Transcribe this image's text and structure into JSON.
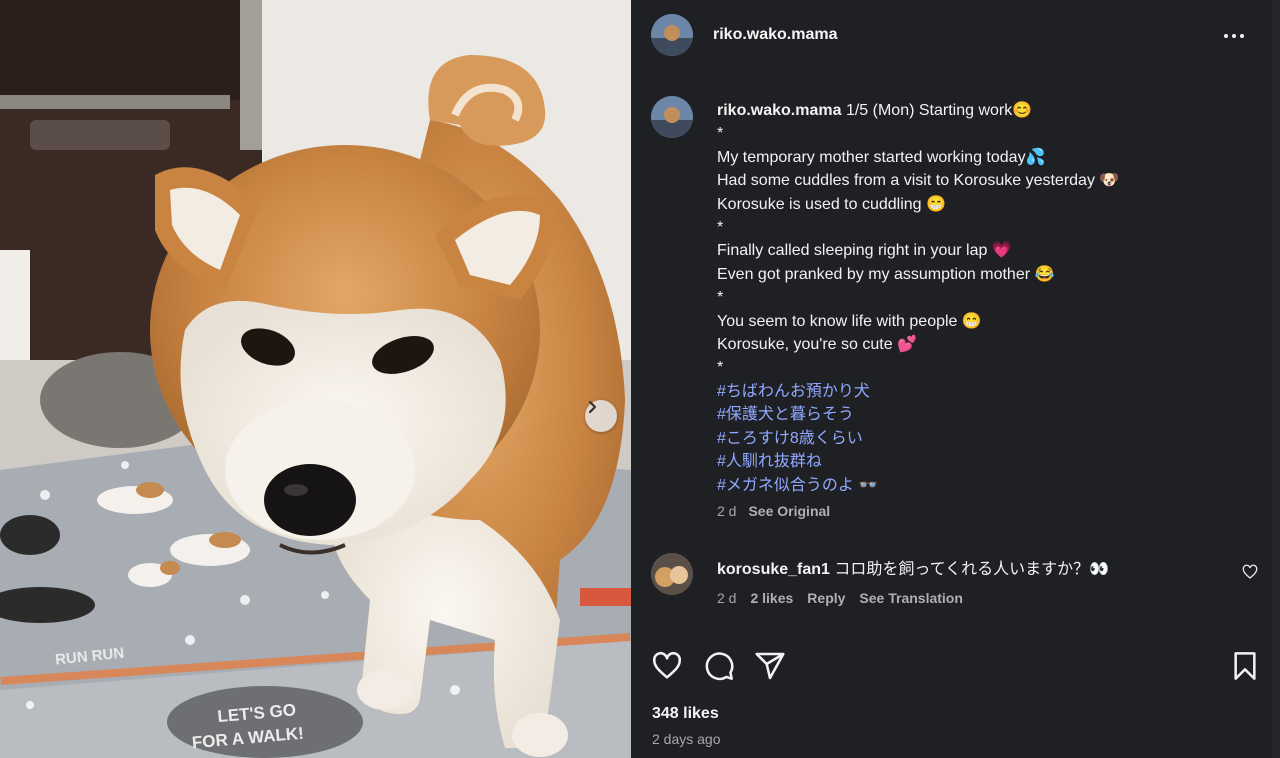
{
  "post": {
    "username": "riko.wako.mama",
    "more_label": "More options",
    "caption": {
      "username": "riko.wako.mama",
      "lines": [
        "1/5 (Mon) Starting work😊",
        " *",
        "My temporary mother started working today💦",
        "Had some cuddles from a visit to Korosuke yesterday 🐶",
        "Korosuke is used to cuddling 😁",
        " *",
        "Finally called sleeping right in your lap 💗",
        "Even got pranked by my assumption mother 😂",
        " *",
        "You seem to know life with people 😁",
        "Korosuke, you're so cute 💕",
        " *"
      ],
      "hashtags": [
        "#ちばわんお預かり犬",
        "#保護犬と暮らそう",
        "#ころすけ8歳くらい",
        "#人馴れ抜群ね",
        "#メガネ似合うのよ 👓"
      ],
      "time": "2 d",
      "see_original": "See Original"
    },
    "comment": {
      "username": "korosuke_fan1",
      "text": "コロ助を飼ってくれる人いますか？👀",
      "time": "2 d",
      "likes": "2 likes",
      "reply": "Reply",
      "see_translation": "See Translation"
    },
    "likes": "348 likes",
    "posted_ago": "2 days ago"
  },
  "photo": {
    "mat_text_1": "RUN RUN",
    "mat_text_2": "LET'S GO",
    "mat_text_3": "FOR A WALK!"
  },
  "icons": {
    "like": "heart-icon",
    "comment": "comment-icon",
    "share": "share-icon",
    "save": "bookmark-icon",
    "next": "chevron-right-icon",
    "more": "more-horizontal-icon"
  },
  "colors": {
    "background": "#1f2024",
    "hashtag": "#8fa8ff",
    "muted": "#a8a8a8"
  }
}
